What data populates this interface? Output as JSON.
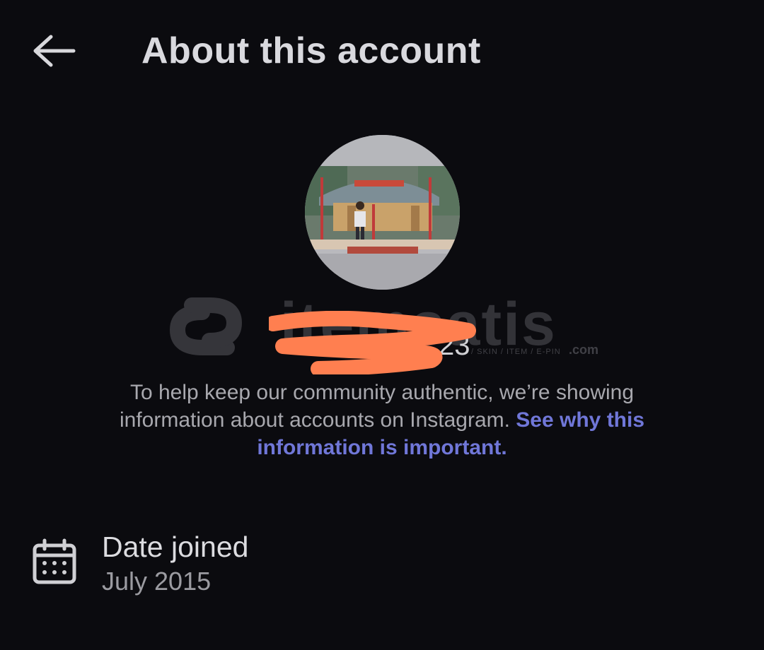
{
  "header": {
    "title": "About this account",
    "back_icon": "arrow-left-icon"
  },
  "profile": {
    "username_visible_fragment": "23"
  },
  "watermark": {
    "brand": "itemsatis",
    "tagline": "/ SKIN / ITEM / E-PIN",
    "suffix": ".com"
  },
  "info": {
    "text": "To help keep our community authentic, we’re showing information about accounts on Instagram.",
    "link_label": "See why this information is important."
  },
  "date_joined": {
    "icon": "calendar-icon",
    "label": "Date joined",
    "value": "July 2015"
  },
  "colors": {
    "background": "#0b0b0f",
    "link": "#7077d8",
    "redaction": "#ff7f50"
  }
}
